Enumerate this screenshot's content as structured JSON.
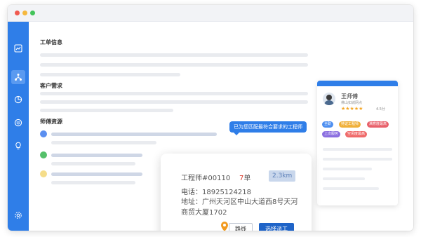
{
  "colors": {
    "primary": "#2f7ee8",
    "dispatch": "#1f64c8",
    "orders_red": "#d93a2b"
  },
  "sidebar": {
    "icons": [
      "chart-icon",
      "network-icon",
      "pie-chart-icon",
      "smile-icon",
      "bulb-icon",
      "settings-icon"
    ],
    "active_index": 1
  },
  "sections": {
    "ticket_info": "工单信息",
    "customer_needs": "客户需求",
    "technician_resources": "师傅资源"
  },
  "tooltip": {
    "text": "已为您匹配最符合要求的工程师"
  },
  "worker_card": {
    "name": "王师傅",
    "shop": "佛山如城网点",
    "stars": "★★★★★",
    "rating": "4.5分",
    "tags": [
      {
        "label": "全职",
        "color": "#4e8ff0"
      },
      {
        "label": "持证工程师",
        "color": "#f0b03a"
      },
      {
        "label": "满意度最高",
        "color": "#e8616b"
      },
      {
        "label": "上次服务",
        "color": "#8b6fe0"
      },
      {
        "label": "空闲度最高",
        "color": "#ef6a6a"
      }
    ]
  },
  "engineer_popup": {
    "id_label": "工程师#00110",
    "orders_count": "7",
    "orders_unit": "单",
    "distance": "2.3km",
    "phone": "电话：18925124218",
    "address": "地址：广州天河区中山大道西8号天河商贸大厦1702",
    "route_label": "路线",
    "dispatch_label": "选择派工"
  }
}
